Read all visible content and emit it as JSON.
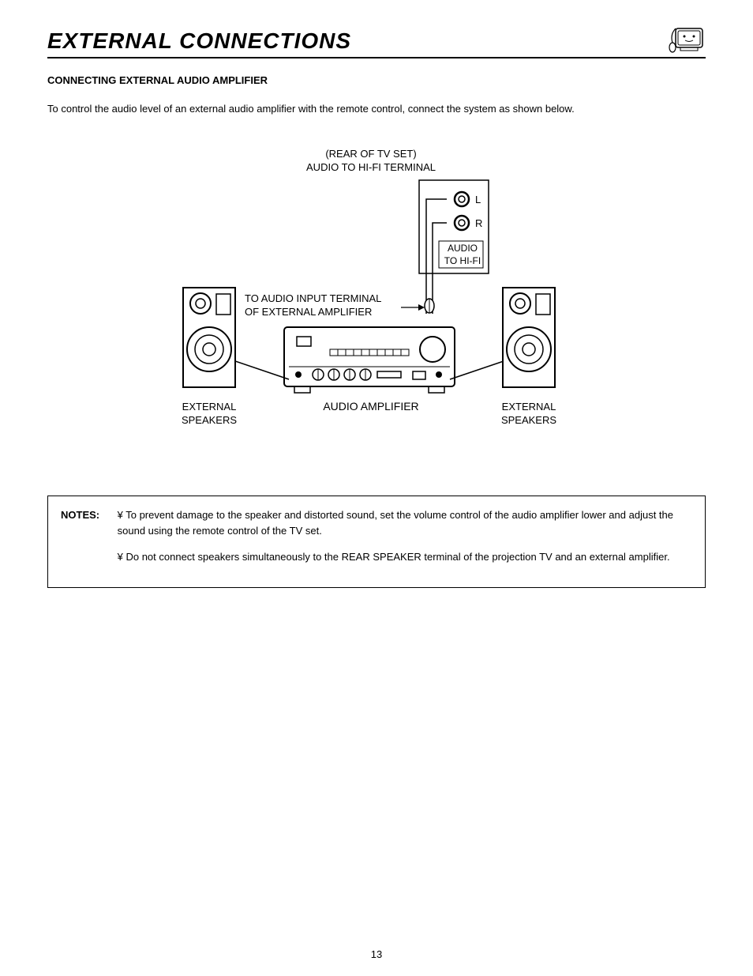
{
  "header": {
    "title": "EXTERNAL CONNECTIONS"
  },
  "section": {
    "subtitle": "CONNECTING EXTERNAL AUDIO AMPLIFIER",
    "intro": "To control the audio level of an external audio amplifier with the remote control, connect the system as shown below."
  },
  "diagram": {
    "rear_tv_line1": "(REAR OF TV SET)",
    "rear_tv_line2": "AUDIO TO HI-FI TERMINAL",
    "jack_l": "L",
    "jack_r": "R",
    "audio_hifi_line1": "AUDIO",
    "audio_hifi_line2": "TO HI-FI",
    "input_terminal_line1": "TO AUDIO INPUT TERMINAL",
    "input_terminal_line2": "OF EXTERNAL AMPLIFIER",
    "amplifier_label": "AUDIO AMPLIFIER",
    "speaker_left_line1": "EXTERNAL",
    "speaker_left_line2": "SPEAKERS",
    "speaker_right_line1": "EXTERNAL",
    "speaker_right_line2": "SPEAKERS"
  },
  "notes": {
    "label": "NOTES:",
    "items": [
      "¥ To prevent damage to the speaker and distorted sound, set the volume control of the audio amplifier lower and adjust the sound using the remote control of the TV set.",
      "¥ Do not connect speakers simultaneously to the REAR SPEAKER terminal of the projection TV and an external amplifier."
    ]
  },
  "page_number": "13"
}
